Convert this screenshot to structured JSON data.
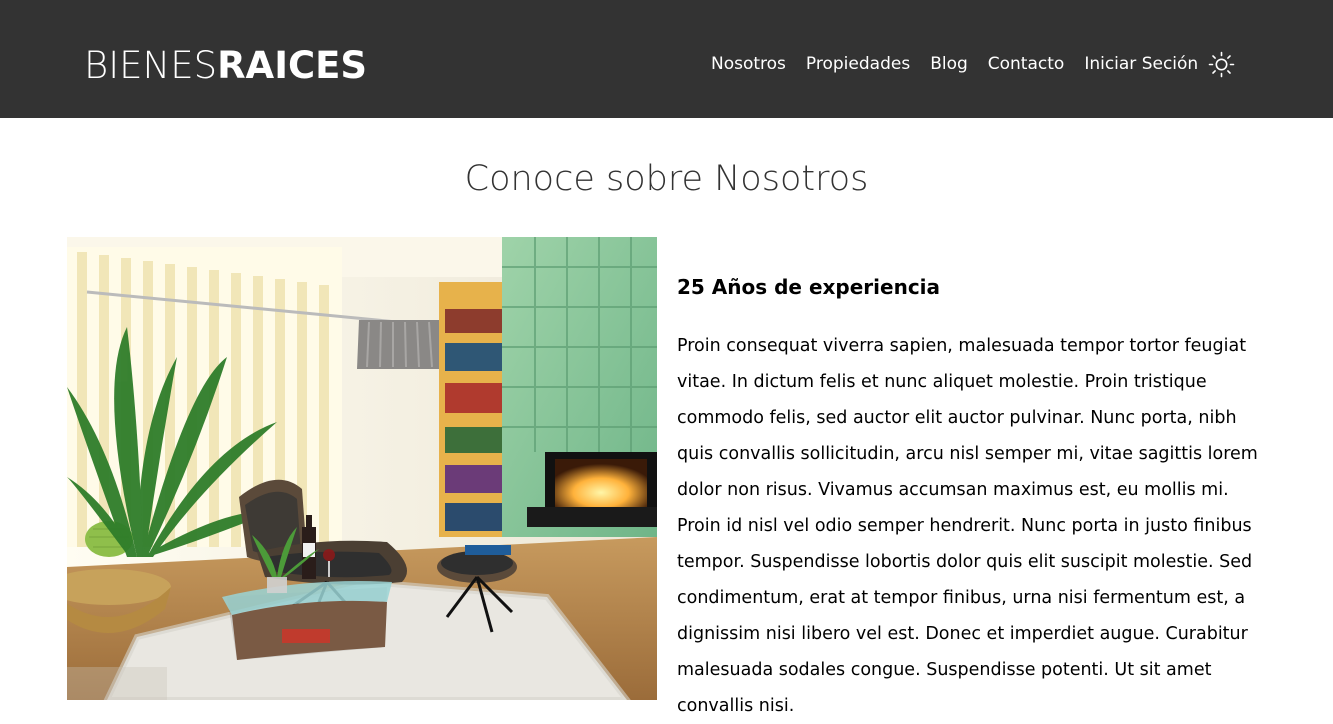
{
  "header": {
    "logo_thin": "BIENES",
    "logo_bold": "RAICES",
    "nav": [
      {
        "label": "Nosotros"
      },
      {
        "label": "Propiedades"
      },
      {
        "label": "Blog"
      },
      {
        "label": "Contacto"
      },
      {
        "label": "Iniciar Seción"
      }
    ],
    "theme_toggle_icon": "sun-icon",
    "background": "#333333"
  },
  "main": {
    "title": "Conoce sobre Nosotros",
    "image_icon": "living-room-photo",
    "heading": "25 Años de experiencia",
    "body": "Proin consequat viverra sapien, malesuada tempor tortor feugiat vitae. In dictum felis et nunc aliquet molestie. Proin tristique commodo felis, sed auctor elit auctor pulvinar. Nunc porta, nibh quis convallis sollicitudin, arcu nisl semper mi, vitae sagittis lorem dolor non risus. Vivamus accumsan maximus est, eu mollis mi. Proin id nisl vel odio semper hendrerit. Nunc porta in justo finibus tempor. Suspendisse lobortis dolor quis elit suscipit molestie. Sed condimentum, erat at tempor finibus, urna nisi fermentum est, a dignissim nisi libero vel est. Donec et imperdiet augue. Curabitur malesuada sodales congue. Suspendisse potenti. Ut sit amet convallis nisi."
  }
}
